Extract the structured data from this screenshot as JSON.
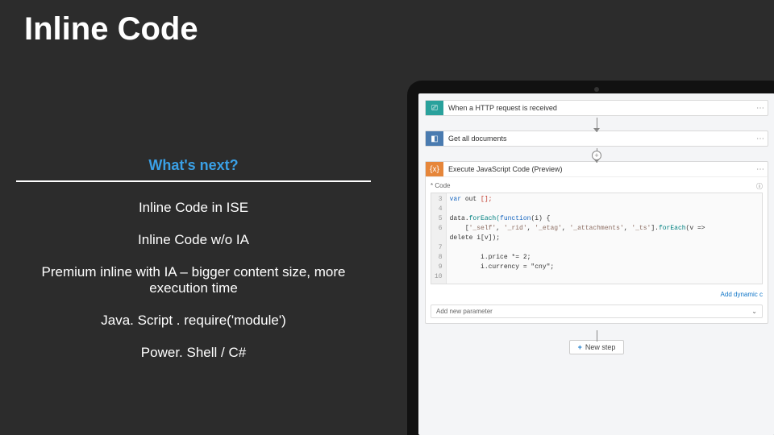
{
  "slide": {
    "title": "Inline Code"
  },
  "whats_next": {
    "header": "What's next?",
    "rows": [
      "Inline Code in ISE",
      "Inline Code w/o IA",
      "Premium inline with IA – bigger content size, more execution time",
      "Java. Script . require('module')",
      "Power. Shell / C#"
    ]
  },
  "designer": {
    "steps": {
      "trigger": {
        "label": "When a HTTP request is received"
      },
      "getdocs": {
        "label": "Get all documents"
      },
      "execjs": {
        "label": "Execute JavaScript Code (Preview)"
      }
    },
    "code": {
      "section_label": "* Code",
      "lines_gutter": "3\n4\n5\n6\n\n7\n8\n9\n10",
      "line3_a": "var",
      "line3_b": " out ",
      "line3_c": "[];",
      "line5_a": "data.",
      "line5_b": "forEach(",
      "line5_c": "function",
      "line5_d": "(i) {",
      "line6_a": "[",
      "line6_b": "'_self'",
      "line6_c": ", ",
      "line6_d": "'_rid'",
      "line6_e": ", ",
      "line6_f": "'_etag'",
      "line6_g": ", ",
      "line6_h": "'_attachments'",
      "line6_i": ", ",
      "line6_j": "'_ts'",
      "line6_k": "].",
      "line6_l": "forEach",
      "line6_m": "(v =>",
      "line6b": "delete i[v]);",
      "line8": "i.price *= 2;",
      "line9": "i.currency = \"cny\";",
      "dynamic_link": "Add dynamic c",
      "add_param": "Add new parameter"
    },
    "new_step": "New step"
  }
}
